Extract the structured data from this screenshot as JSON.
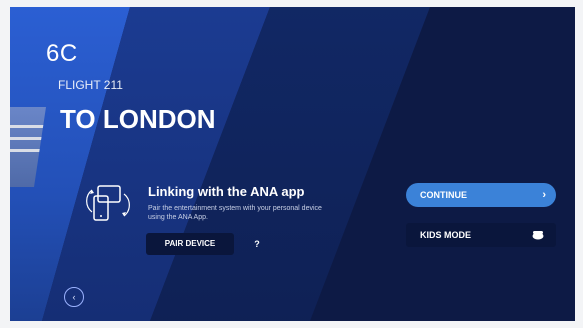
{
  "seat": {
    "label": "6C"
  },
  "flight": {
    "label": "FLIGHT 211",
    "destination": "TO LONDON"
  },
  "linking": {
    "title": "Linking with the ANA app",
    "description": "Pair the entertainment system with your personal device using the ANA App.",
    "pair_label": "PAIR DEVICE",
    "help_label": "?"
  },
  "actions": {
    "continue_label": "CONTINUE",
    "continue_chevron": "›",
    "kids_label": "KIDS MODE"
  },
  "nav": {
    "back_symbol": "‹"
  },
  "colors": {
    "background": "#0d1a45",
    "accent": "#3b82d8",
    "button_dark": "#0a163c"
  },
  "icons": {
    "link": "device-link-icon",
    "kids": "kids-mode-icon",
    "back": "back-icon",
    "continue": "chevron-right-icon"
  }
}
